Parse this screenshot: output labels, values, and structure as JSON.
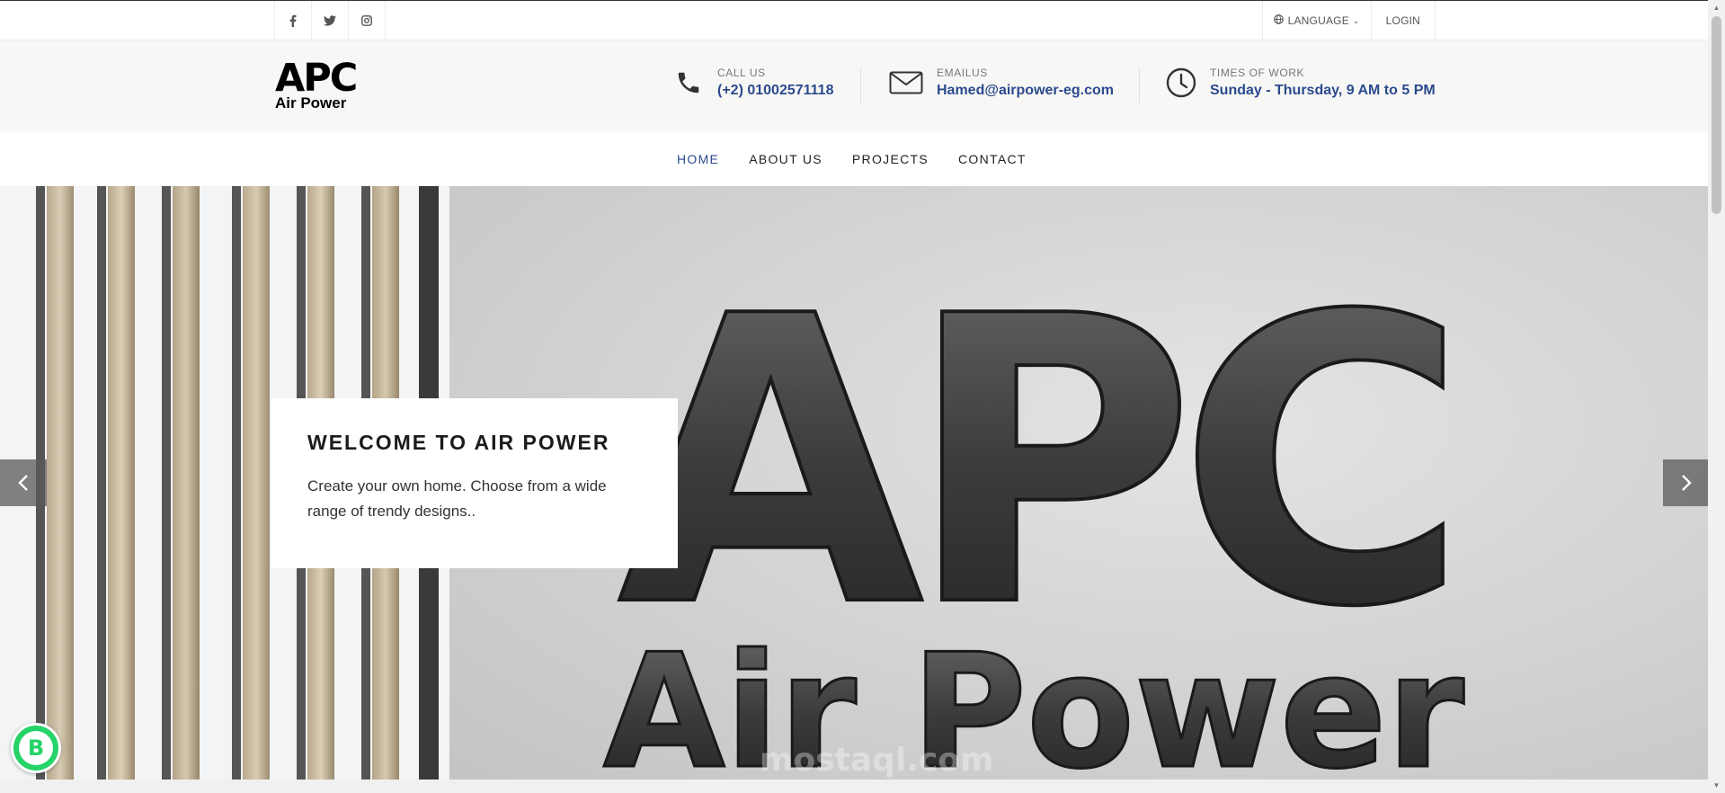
{
  "topbar": {
    "social": [
      {
        "icon": "facebook-icon",
        "glyph": "f"
      },
      {
        "icon": "twitter-icon",
        "glyph": "🐦"
      },
      {
        "icon": "instagram-icon",
        "glyph": "◎"
      }
    ],
    "language_label": "LANGUAGE",
    "login_label": "LOGIN"
  },
  "header": {
    "logo_mark": "APC",
    "logo_sub": "Air Power",
    "call": {
      "label": "CALL US",
      "value": "(+2) 01002571118"
    },
    "email": {
      "label": "EMAILUS",
      "value": "Hamed@airpower-eg.com"
    },
    "hours": {
      "label": "TIMES OF WORK",
      "value": "Sunday - Thursday, 9 AM to 5 PM"
    }
  },
  "nav": {
    "items": [
      "HOME",
      "ABOUT US",
      "PROJECTS",
      "CONTACT"
    ],
    "active": "HOME"
  },
  "hero": {
    "title": "WELCOME TO AIR POWER",
    "text": "Create your own home. Choose from a wide range of trendy designs..",
    "image_logo_mark": "APC",
    "image_logo_sub": "Air Power",
    "watermark": "mostaql.com"
  },
  "colors": {
    "accent": "#2c4a8e",
    "whatsapp": "#25d366"
  }
}
